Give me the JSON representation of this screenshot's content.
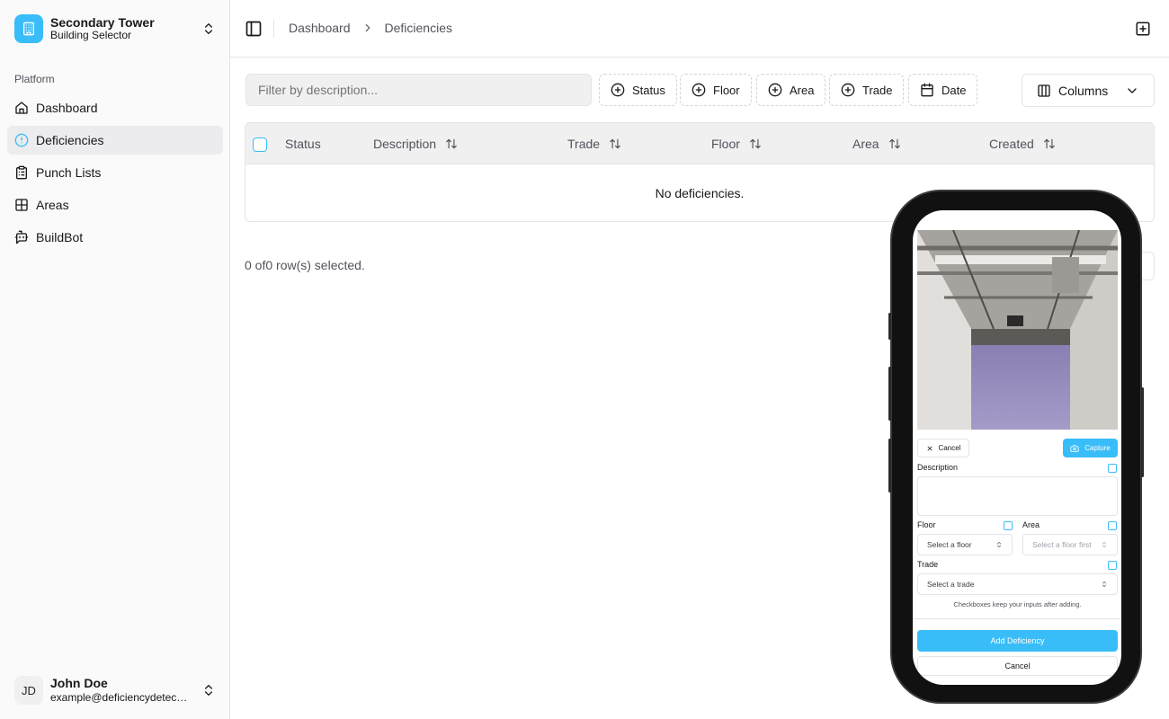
{
  "building": {
    "name": "Secondary Tower",
    "subtitle": "Building Selector"
  },
  "sidebar": {
    "group_label": "Platform",
    "items": [
      {
        "label": "Dashboard",
        "icon": "home-icon"
      },
      {
        "label": "Deficiencies",
        "icon": "alert-circle-icon",
        "active": true
      },
      {
        "label": "Punch Lists",
        "icon": "clipboard-list-icon"
      },
      {
        "label": "Areas",
        "icon": "layout-grid-icon"
      },
      {
        "label": "BuildBot",
        "icon": "bot-message-icon"
      }
    ]
  },
  "user": {
    "initials": "JD",
    "name": "John Doe",
    "email": "example@deficiencydetect...."
  },
  "header": {
    "breadcrumbs": [
      "Dashboard",
      "Deficiencies"
    ]
  },
  "toolbar": {
    "filter_placeholder": "Filter by description...",
    "filters": [
      "Status",
      "Floor",
      "Area",
      "Trade",
      "Date"
    ],
    "columns_label": "Columns"
  },
  "table": {
    "columns": [
      "Status",
      "Description",
      "Trade",
      "Floor",
      "Area",
      "Created"
    ],
    "empty_text": "No deficiencies.",
    "selection_text": "0 of0 row(s) selected."
  },
  "mobile_form": {
    "cancel_label": "Cancel",
    "capture_label": "Capture",
    "description_label": "Description",
    "floor_label": "Floor",
    "floor_placeholder": "Select a floor",
    "area_label": "Area",
    "area_placeholder": "Select a floor first",
    "trade_label": "Trade",
    "trade_placeholder": "Select a trade",
    "hint": "Checkboxes keep your inputs after adding.",
    "add_label": "Add Deficiency",
    "cancel_bottom_label": "Cancel"
  },
  "colors": {
    "accent": "#38bdf8",
    "sidebar_bg": "#fafafa",
    "border": "#e4e4e7"
  }
}
